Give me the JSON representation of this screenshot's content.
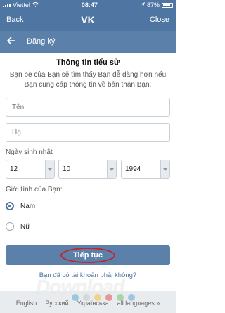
{
  "status_bar": {
    "carrier": "Viettel",
    "time": "08:47",
    "battery": "87%",
    "battery_level": 0.87
  },
  "nav": {
    "back_label": "Back",
    "title": "VK",
    "close_label": "Close"
  },
  "subheader": {
    "title": "Đăng ký"
  },
  "section": {
    "title": "Thông tin tiểu sử",
    "description": "Bạn bè của Bạn sẽ tìm thấy Bạn dễ dàng hơn nếu Bạn cung cấp thông tin về bản thân Bạn."
  },
  "form": {
    "first_name_placeholder": "Tên",
    "last_name_placeholder": "Họ",
    "birthday_label": "Ngày sinh nhật",
    "birthday_day": "12",
    "birthday_month": "10",
    "birthday_year": "1994",
    "gender_label": "Giới tính của Bạn:",
    "gender_options": [
      {
        "label": "Nam",
        "selected": true
      },
      {
        "label": "Nữ",
        "selected": false
      }
    ],
    "continue_label": "Tiếp tục",
    "account_question": "Bạn đã có tài khoản phải không?"
  },
  "footer": {
    "languages": [
      "English",
      "Русский",
      "Українська",
      "all languages »"
    ]
  },
  "watermark": {
    "text": "Download",
    "dot_colors": [
      "#6aaed6",
      "#c9c9c9",
      "#f4c542",
      "#e06060",
      "#7bc47b",
      "#6aaed6"
    ]
  },
  "colors": {
    "brand": "#4f76a3",
    "highlight_ring": "#c0242c"
  }
}
